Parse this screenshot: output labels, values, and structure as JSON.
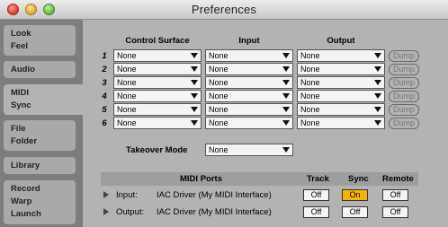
{
  "window": {
    "title": "Preferences"
  },
  "sidebar": {
    "tabs": [
      {
        "line1": "Look",
        "line2": "Feel"
      },
      {
        "line1": "Audio",
        "line2": ""
      },
      {
        "line1": "MIDI",
        "line2": "Sync"
      },
      {
        "line1": "File",
        "line2": "Folder"
      },
      {
        "line1": "Library",
        "line2": ""
      },
      {
        "line1": "Record",
        "line2": "Warp",
        "line3": "Launch"
      }
    ]
  },
  "midi": {
    "headers": {
      "control_surface": "Control Surface",
      "input": "Input",
      "output": "Output"
    },
    "rows": [
      {
        "num": "1",
        "control_surface": "None",
        "input": "None",
        "output": "None",
        "dump": "Dump"
      },
      {
        "num": "2",
        "control_surface": "None",
        "input": "None",
        "output": "None",
        "dump": "Dump"
      },
      {
        "num": "3",
        "control_surface": "None",
        "input": "None",
        "output": "None",
        "dump": "Dump"
      },
      {
        "num": "4",
        "control_surface": "None",
        "input": "None",
        "output": "None",
        "dump": "Dump"
      },
      {
        "num": "5",
        "control_surface": "None",
        "input": "None",
        "output": "None",
        "dump": "Dump"
      },
      {
        "num": "6",
        "control_surface": "None",
        "input": "None",
        "output": "None",
        "dump": "Dump"
      }
    ],
    "takeover_mode": {
      "label": "Takeover Mode",
      "value": "None"
    }
  },
  "ports": {
    "headers": {
      "midi_ports": "MIDI Ports",
      "track": "Track",
      "sync": "Sync",
      "remote": "Remote"
    },
    "rows": [
      {
        "label": "Input:",
        "name": "IAC Driver (My MIDI Interface)",
        "track": "Off",
        "sync": "On",
        "remote": "Off"
      },
      {
        "label": "Output:",
        "name": "IAC Driver (My MIDI Interface)",
        "track": "Off",
        "sync": "Off",
        "remote": "Off"
      }
    ]
  },
  "colors": {
    "toggle_on": "#f6b400",
    "panel_bg": "#b3b3b3",
    "sidebar_bg": "#7d7d7d"
  }
}
